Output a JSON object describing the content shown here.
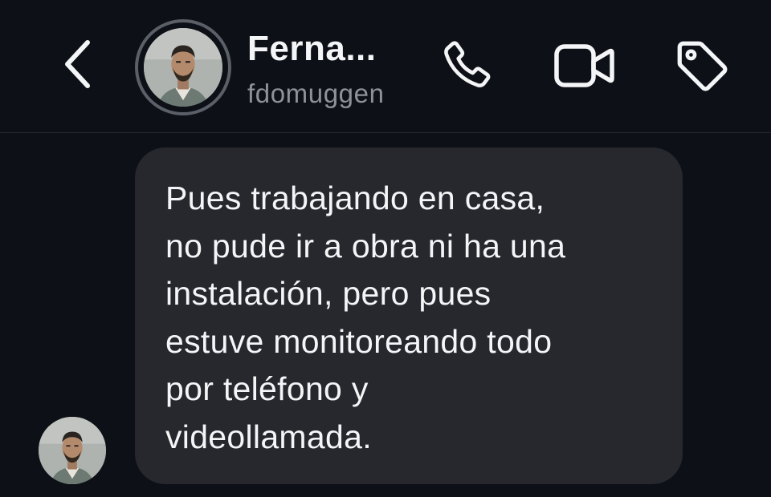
{
  "header": {
    "contact_name": "Ferna...",
    "username": "fdomuggen"
  },
  "icons": {
    "back": "chevron-left-icon",
    "phone": "phone-icon",
    "video": "video-camera-icon",
    "tag": "tag-icon"
  },
  "messages": [
    {
      "direction": "incoming",
      "lines": [
        "Pues trabajando en casa,",
        "no pude ir a obra ni ha una",
        "instalación, pero pues",
        "estuve monitoreando todo",
        "por teléfono y",
        "videollamada."
      ]
    }
  ],
  "colors": {
    "background": "#0d1016",
    "bubble": "#26282d",
    "text": "#f4f5f7",
    "secondary_text": "#8d9299"
  }
}
